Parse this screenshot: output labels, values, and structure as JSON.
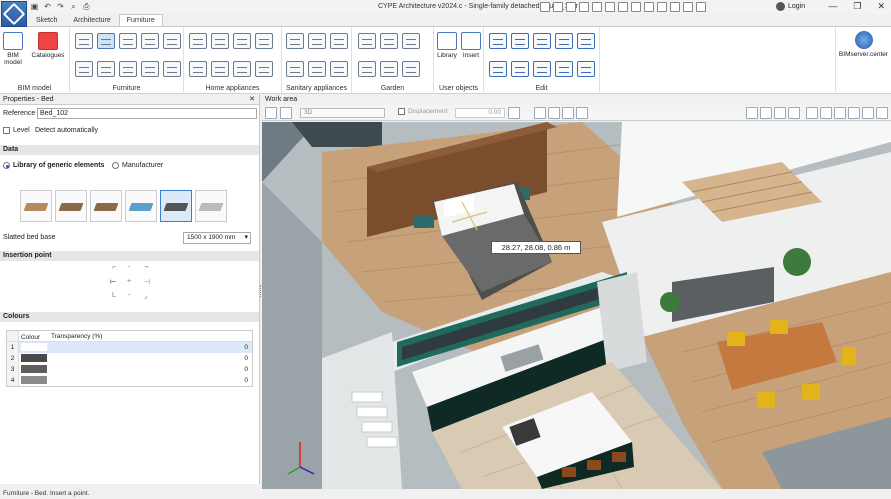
{
  "app": {
    "title": "CYPE Architecture v2024.c - Single-family detached house_1.str",
    "login": "Login",
    "window_buttons": [
      "—",
      "❐",
      "✕"
    ]
  },
  "tabs": [
    {
      "label": "Sketch"
    },
    {
      "label": "Architecture"
    },
    {
      "label": "Furniture"
    }
  ],
  "ribbon": {
    "bim_model": {
      "button": "BIM model",
      "catalogues": "Catalogues",
      "group_label": "BIM model"
    },
    "furniture": {
      "group_label": "Furniture"
    },
    "home_appliances": {
      "group_label": "Home appliances"
    },
    "sanitary": {
      "group_label": "Sanitary appliances"
    },
    "garden": {
      "group_label": "Garden"
    },
    "user_objects": {
      "library": "Library",
      "insert": "Insert",
      "group_label": "User objects"
    },
    "edit": {
      "group_label": "Edit"
    },
    "bimserver": "BIMserver.center"
  },
  "panel": {
    "title": "Properties - Bed",
    "reference_label": "Reference",
    "reference_value": "Bed_102",
    "level_label": "Level",
    "detect_label": "Detect automatically",
    "data_section": "Data",
    "library_option": "Library of generic elements",
    "manufacturer_option": "Manufacturer",
    "bed_base_label": "Slatted bed base",
    "bed_size": "1500 x 1900 mm",
    "insertion_section": "Insertion point",
    "colours_section": "Colours",
    "colours_table": {
      "headers": [
        "Colour",
        "Transparency (%)"
      ],
      "rows": [
        {
          "index": "1",
          "color": "#ffffff",
          "transparency": "0"
        },
        {
          "index": "2",
          "color": "#4a4a4a",
          "transparency": "0"
        },
        {
          "index": "3",
          "color": "#5e5e5e",
          "transparency": "0"
        },
        {
          "index": "4",
          "color": "#8a8a8a",
          "transparency": "0"
        }
      ]
    }
  },
  "work_area": {
    "title": "Work area",
    "view_mode": "3D",
    "displacement_label": "Displacement",
    "displacement_value": "0.00",
    "coordinate_readout": "28.27, 28.08, 0.86 m"
  },
  "status": "Furniture - Bed. Insert a point."
}
